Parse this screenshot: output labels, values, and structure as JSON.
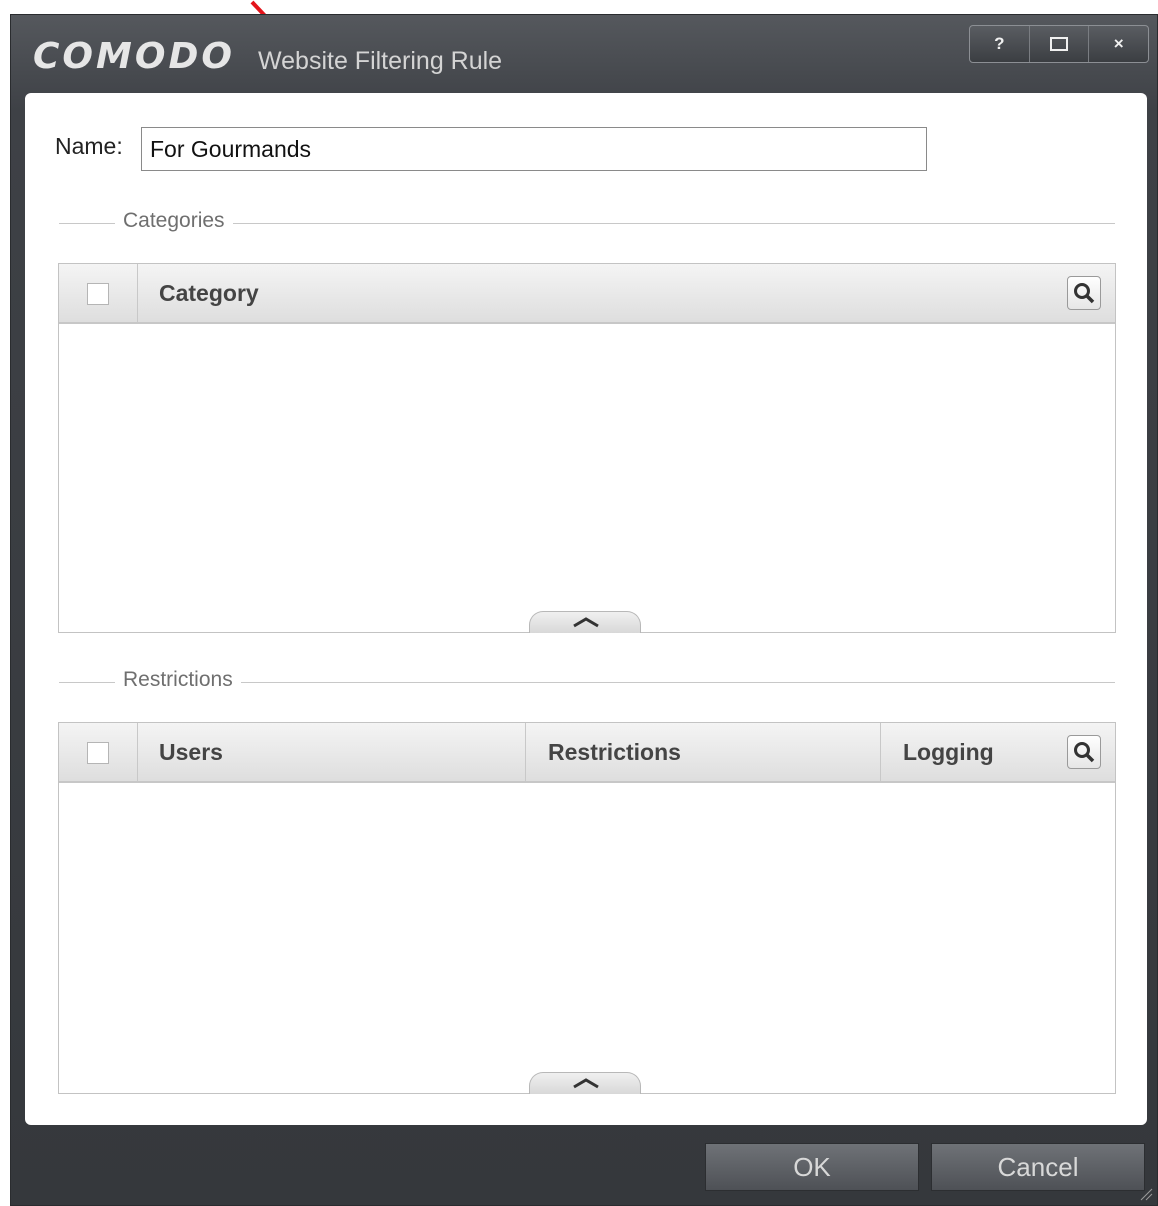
{
  "window": {
    "logo": "COMODO",
    "title": "Website Filtering Rule",
    "controls": {
      "help": "?",
      "maximize": "☐",
      "close": "×"
    }
  },
  "form": {
    "name_label": "Name:",
    "name_value": "For Gourmands"
  },
  "categories": {
    "section_label": "Categories",
    "columns": [
      "Category"
    ]
  },
  "restrictions": {
    "section_label": "Restrictions",
    "columns": [
      "Users",
      "Restrictions",
      "Logging"
    ]
  },
  "buttons": {
    "ok": "OK",
    "cancel": "Cancel"
  },
  "colors": {
    "annotation_arrow": "#e3141b",
    "title_bar": "#3e4146"
  }
}
